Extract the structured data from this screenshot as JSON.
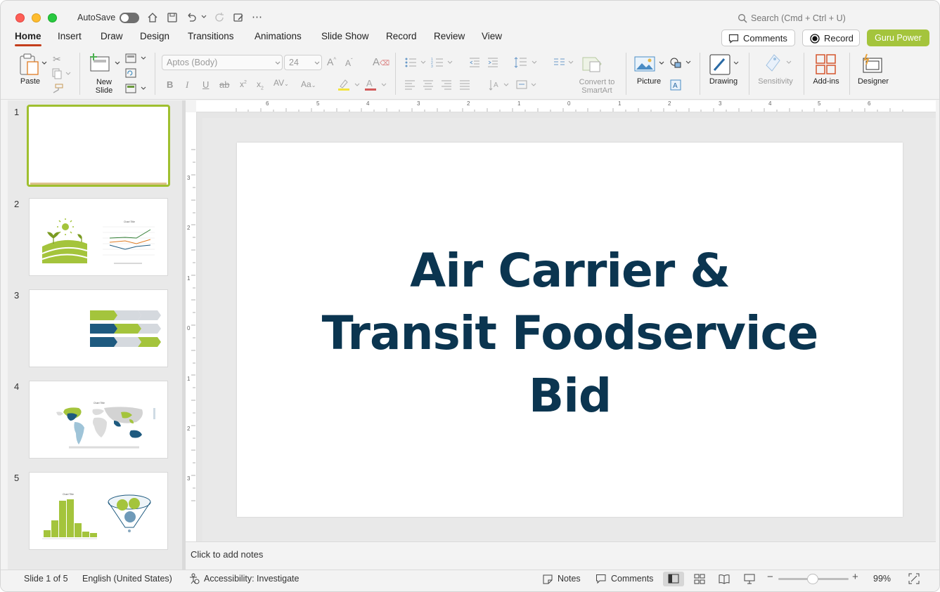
{
  "titlebar": {
    "autosave": "AutoSave",
    "search_placeholder": "Search (Cmd + Ctrl + U)"
  },
  "tabs": [
    "Home",
    "Insert",
    "Draw",
    "Design",
    "Transitions",
    "Animations",
    "Slide Show",
    "Record",
    "Review",
    "View"
  ],
  "header_buttons": {
    "comments": "Comments",
    "record": "Record",
    "guru": "Guru Power"
  },
  "ribbon": {
    "paste": "Paste",
    "new_slide_1": "New",
    "new_slide_2": "Slide",
    "font_name": "Aptos (Body)",
    "font_size": "24",
    "convert_1": "Convert to",
    "convert_2": "SmartArt",
    "picture": "Picture",
    "drawing": "Drawing",
    "sensitivity": "Sensitivity",
    "addins": "Add-ins",
    "designer": "Designer"
  },
  "ruler": {
    "h": [
      "6",
      "5",
      "4",
      "3",
      "2",
      "1",
      "0",
      "1",
      "2",
      "3",
      "4",
      "5",
      "6"
    ],
    "v": [
      "3",
      "2",
      "1",
      "0",
      "1",
      "2",
      "3"
    ]
  },
  "slides": [
    {
      "num": "1"
    },
    {
      "num": "2",
      "chart_title": "Chart Title"
    },
    {
      "num": "3"
    },
    {
      "num": "4",
      "chart_title": "Chart Title"
    },
    {
      "num": "5",
      "chart_title": "Chart Title"
    }
  ],
  "slide": {
    "title_line1": "Air Carrier &",
    "title_line2": "Transit Foodservice",
    "title_line3": "Bid"
  },
  "notes_placeholder": "Click to add notes",
  "statusbar": {
    "slide_of": "Slide 1 of 5",
    "language": "English (United States)",
    "accessibility": "Accessibility: Investigate",
    "notes": "Notes",
    "comments": "Comments",
    "zoom": "99%"
  },
  "colors": {
    "accent": "#a4c43c",
    "title": "#0b3550",
    "navy": "#1e5a7f"
  }
}
